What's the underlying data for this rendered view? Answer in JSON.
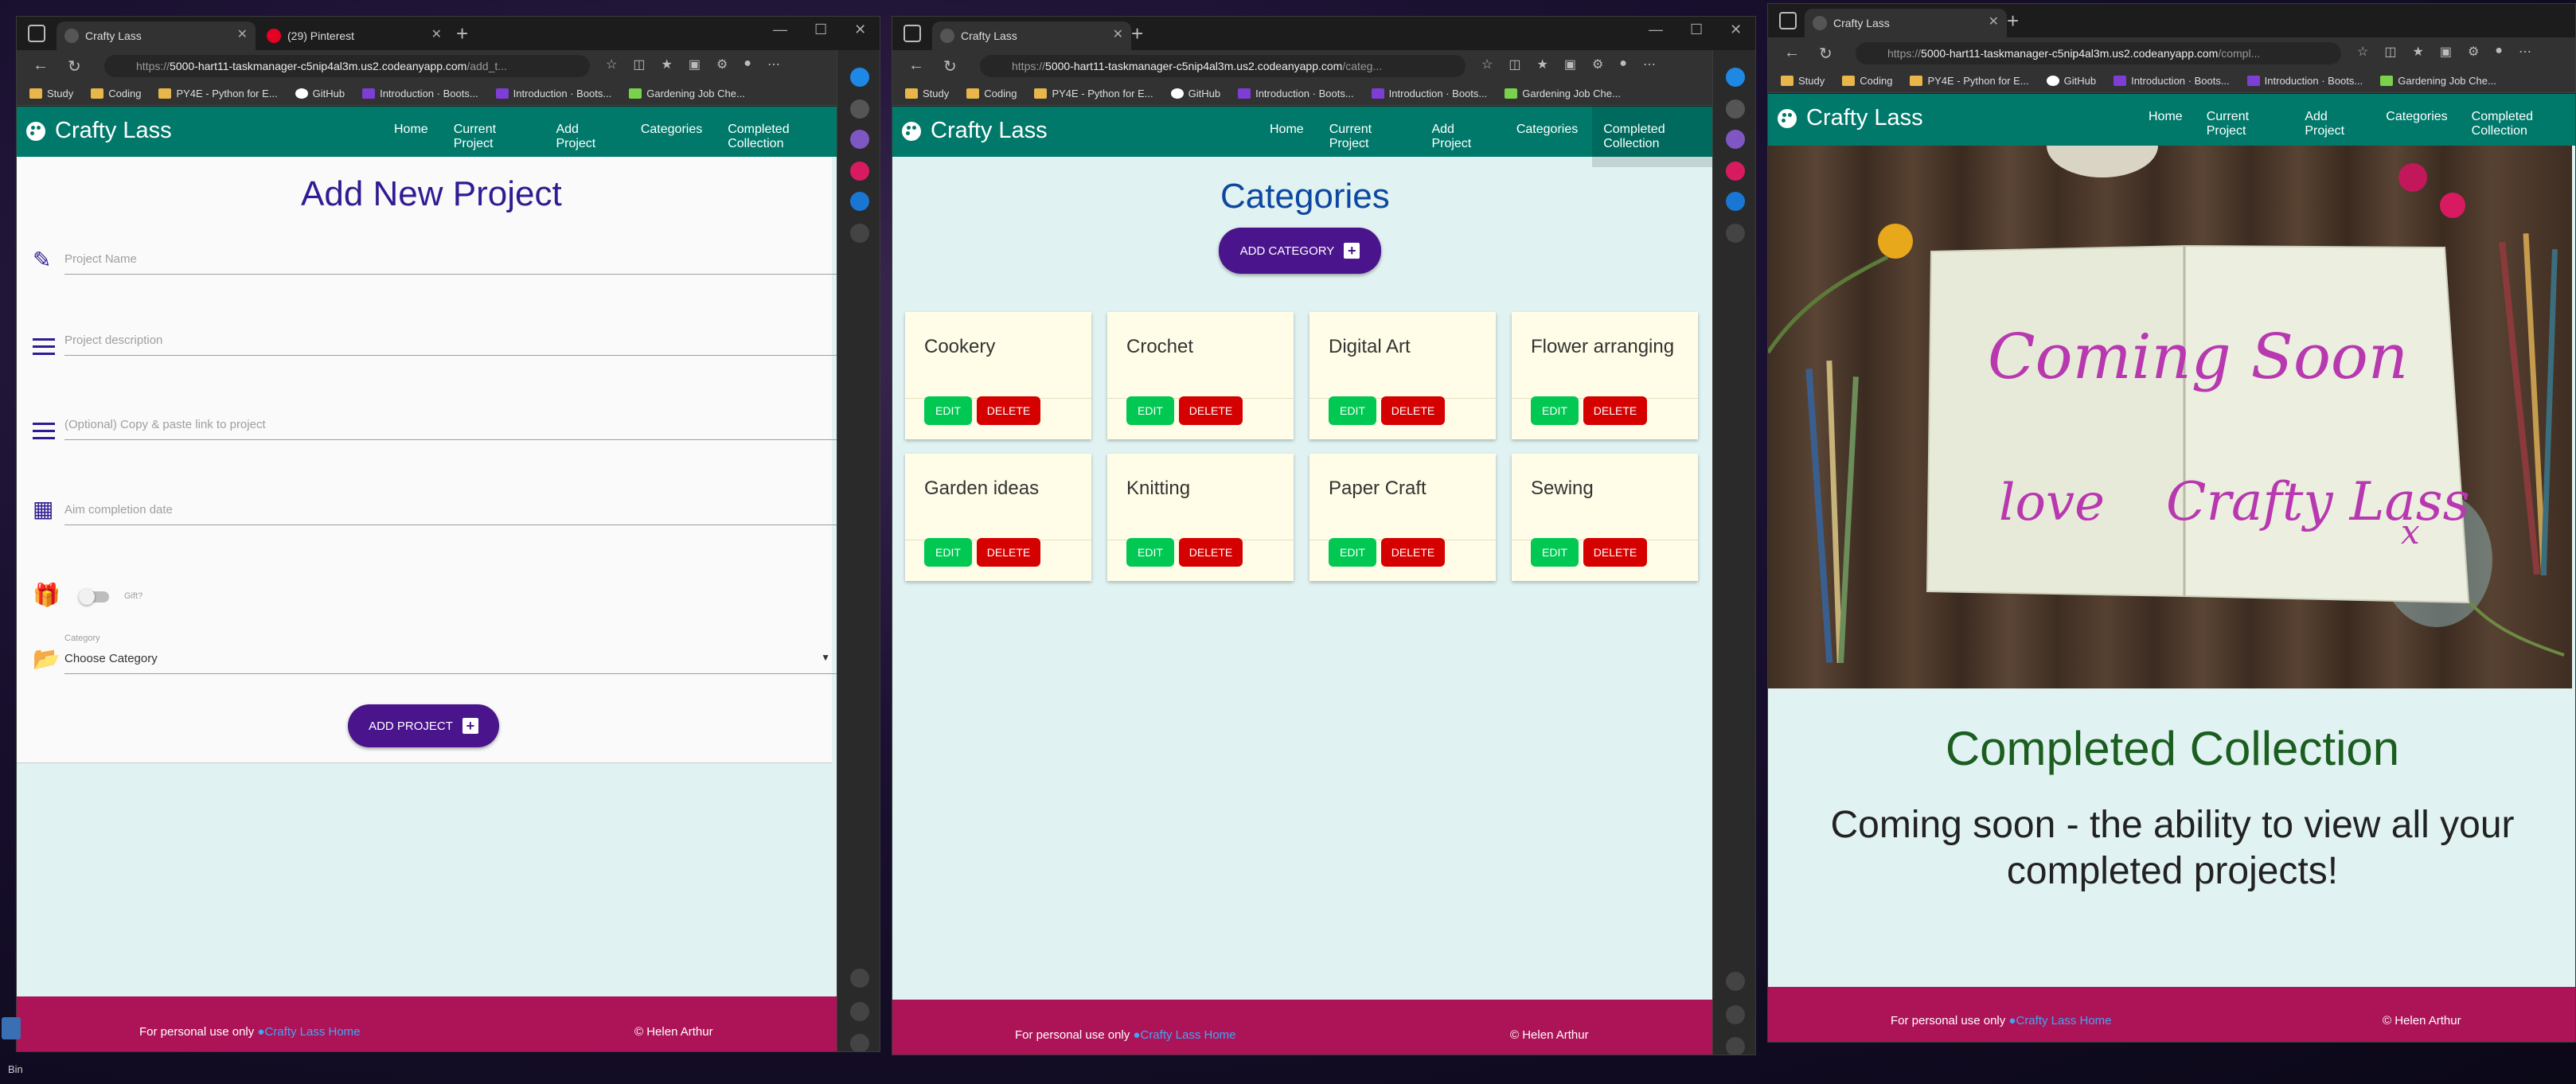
{
  "brand_colors": {
    "navbar": "#00796b",
    "footer": "#ad1457",
    "heading": "#311b92",
    "primary_button": "#4a148c",
    "edit": "#00c853",
    "delete": "#d50000"
  },
  "windows": [
    {
      "tabs": [
        {
          "title": "Crafty Lass",
          "active": true
        },
        {
          "title": "(29) Pinterest",
          "active": false
        }
      ],
      "url": {
        "scheme": "https://",
        "host": "5000-hart11-taskmanager-c5nip4al3m.us2.codeanyapp.com",
        "path": "/add_t..."
      },
      "page_heading": "Add New Project",
      "form": {
        "project_name": "Project Name",
        "project_description": "Project description",
        "link": "(Optional) Copy & paste link to project",
        "date": "Aim completion date",
        "gift_label": "Gift?",
        "category_label": "Category",
        "category_value": "Choose Category",
        "submit": "ADD PROJECT"
      }
    },
    {
      "tabs": [
        {
          "title": "Crafty Lass",
          "active": true
        }
      ],
      "url": {
        "scheme": "https://",
        "host": "5000-hart11-taskmanager-c5nip4al3m.us2.codeanyapp.com",
        "path": "/categ..."
      },
      "page_heading": "Categories",
      "add_category": "ADD CATEGORY",
      "categories": [
        "Cookery",
        "Crochet",
        "Digital Art",
        "Flower arranging",
        "Garden ideas",
        "Knitting",
        "Paper Craft",
        "Sewing"
      ],
      "edit_label": "EDIT",
      "delete_label": "DELETE"
    },
    {
      "tabs": [
        {
          "title": "Crafty Lass",
          "active": true
        }
      ],
      "url": {
        "scheme": "https://",
        "host": "5000-hart11-taskmanager-c5nip4al3m.us2.codeanyapp.com",
        "path": "/compl..."
      },
      "hero_writing": [
        "Coming Soon",
        "love",
        "Crafty Lass",
        "x"
      ],
      "page_heading": "Completed Collection",
      "subheading": "Coming soon - the ability to view all your completed projects!"
    }
  ],
  "bookmarks": [
    "Study",
    "Coding",
    "PY4E - Python for E...",
    "GitHub",
    "Introduction · Boots...",
    "Introduction · Boots...",
    "Gardening Job Che..."
  ],
  "nav": {
    "brand": "Crafty Lass",
    "links": [
      "Home",
      "Current Project",
      "Add Project",
      "Categories",
      "Completed Collection"
    ]
  },
  "footer": {
    "note": "For personal use only",
    "link": "Crafty Lass Home",
    "copyright": "© Helen Arthur"
  },
  "taskbar": {
    "label": "Bin"
  }
}
